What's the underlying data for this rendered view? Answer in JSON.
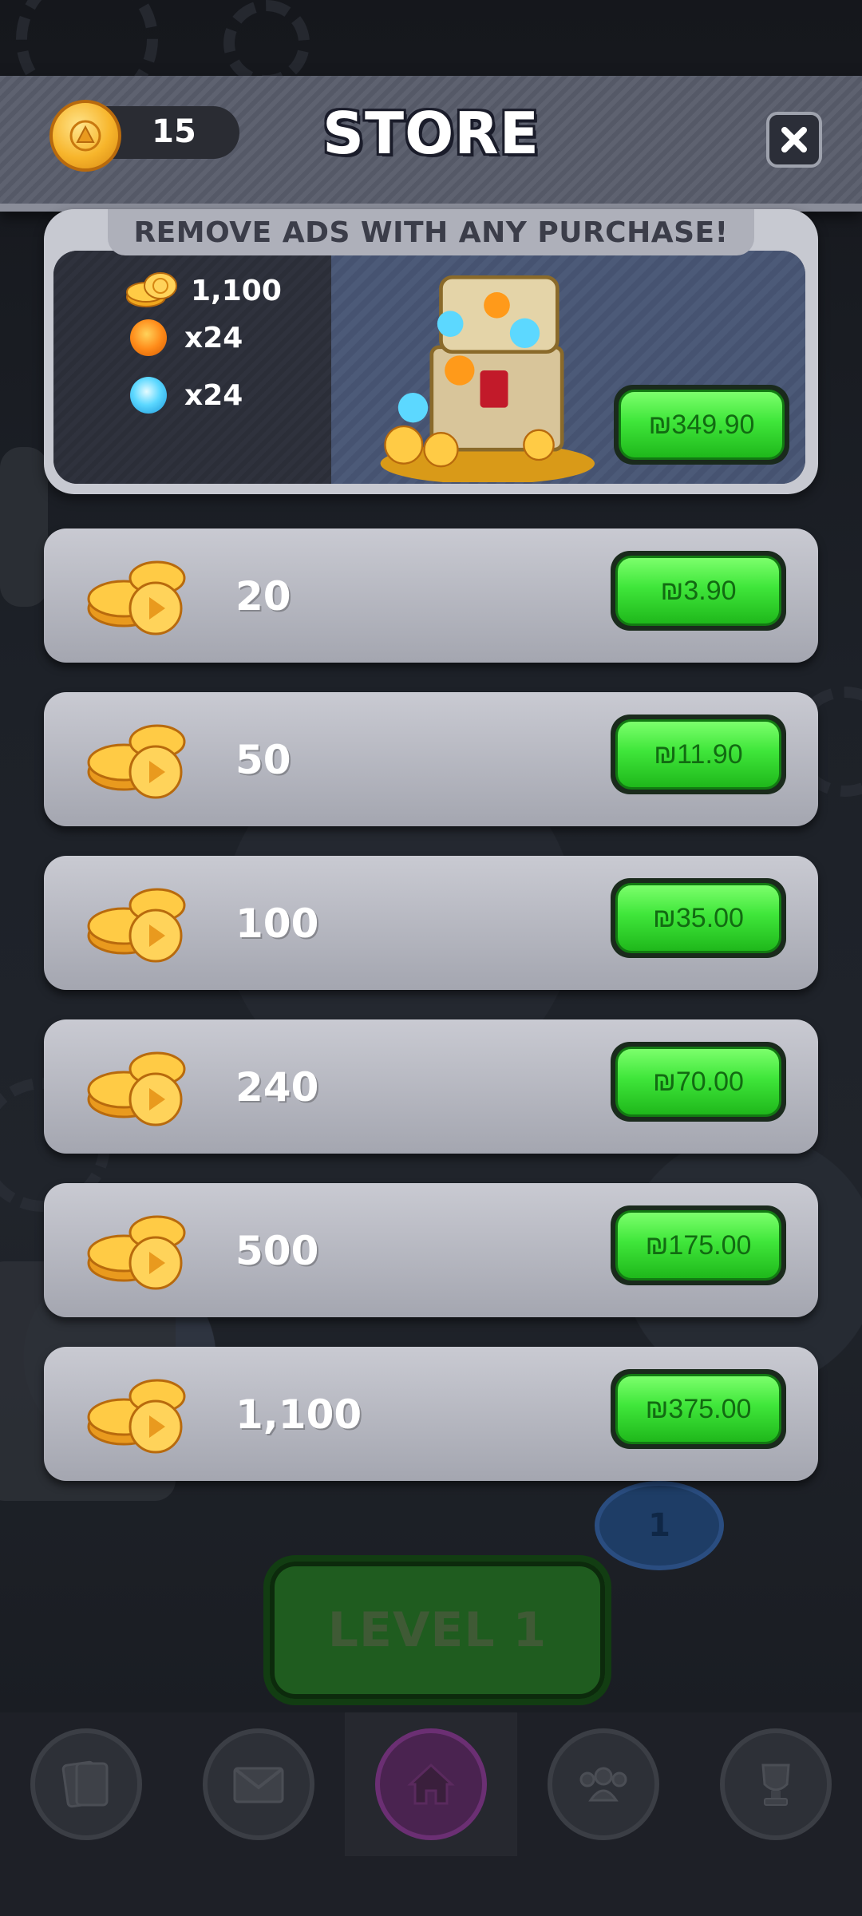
{
  "header": {
    "coin_balance": "15",
    "title": "STORE"
  },
  "bundle": {
    "banner": "REMOVE ADS WITH ANY PURCHASE!",
    "items": [
      {
        "icon": "coins-icon",
        "value": "1,100"
      },
      {
        "icon": "fire-orb-icon",
        "value": "x24"
      },
      {
        "icon": "ice-orb-icon",
        "value": "x24"
      }
    ],
    "price": "₪349.90"
  },
  "offers": [
    {
      "amount": "20",
      "price": "₪3.90"
    },
    {
      "amount": "50",
      "price": "₪11.90"
    },
    {
      "amount": "100",
      "price": "₪35.00"
    },
    {
      "amount": "240",
      "price": "₪70.00"
    },
    {
      "amount": "500",
      "price": "₪175.00"
    },
    {
      "amount": "1,100",
      "price": "₪375.00"
    }
  ],
  "background": {
    "level_button": "LEVEL 1",
    "level_badge": "1"
  },
  "bottom_nav": [
    {
      "icon": "cards-icon"
    },
    {
      "icon": "mail-icon"
    },
    {
      "icon": "home-icon",
      "active": true
    },
    {
      "icon": "team-icon"
    },
    {
      "icon": "trophy-icon"
    }
  ],
  "colors": {
    "price_button": "#3fe63a",
    "header": "#5e6270",
    "card": "#c9cad2"
  }
}
